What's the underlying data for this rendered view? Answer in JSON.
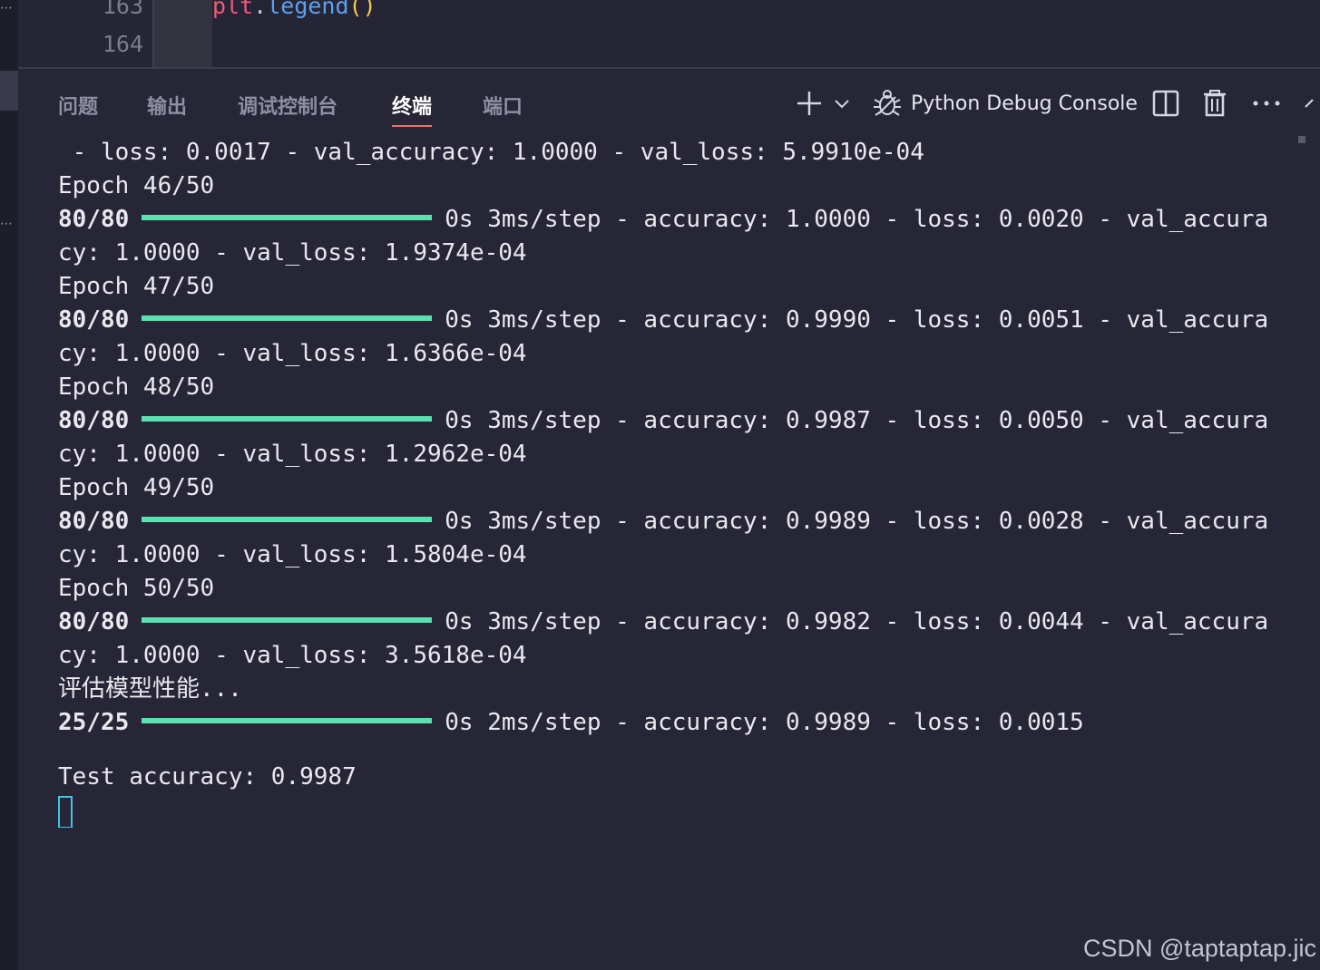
{
  "editor": {
    "line_numbers": [
      "163",
      "164"
    ],
    "code": {
      "var": "plt",
      "dot": ".",
      "fn": "legend",
      "parens": "()"
    }
  },
  "panel": {
    "tabs": [
      {
        "label": "问题"
      },
      {
        "label": "输出"
      },
      {
        "label": "调试控制台"
      },
      {
        "label": "终端",
        "active": true
      },
      {
        "label": "端口"
      }
    ],
    "toolbar": {
      "add_icon": "plus-icon",
      "dropdown_icon": "chevron-down-icon",
      "debug_icon": "bug-icon",
      "console_name": "Python Debug Console",
      "split_icon": "split-icon",
      "trash_icon": "trash-icon",
      "more_icon": "ellipsis-icon",
      "collapse_icon": "chevron-up-icon"
    }
  },
  "terminal": {
    "first_line": " - loss: 0.0017 - val_accuracy: 1.0000 - val_loss: 5.9910e-04",
    "epochs": [
      {
        "header": "Epoch 46/50",
        "steps": "80/80",
        "stats": "0s 3ms/step - accuracy: 1.0000 - loss: 0.0020 - val_accura",
        "wrap": "cy: 1.0000 - val_loss: 1.9374e-04"
      },
      {
        "header": "Epoch 47/50",
        "steps": "80/80",
        "stats": "0s 3ms/step - accuracy: 0.9990 - loss: 0.0051 - val_accura",
        "wrap": "cy: 1.0000 - val_loss: 1.6366e-04"
      },
      {
        "header": "Epoch 48/50",
        "steps": "80/80",
        "stats": "0s 3ms/step - accuracy: 0.9987 - loss: 0.0050 - val_accura",
        "wrap": "cy: 1.0000 - val_loss: 1.2962e-04"
      },
      {
        "header": "Epoch 49/50",
        "steps": "80/80",
        "stats": "0s 3ms/step - accuracy: 0.9989 - loss: 0.0028 - val_accura",
        "wrap": "cy: 1.0000 - val_loss: 1.5804e-04"
      },
      {
        "header": "Epoch 50/50",
        "steps": "80/80",
        "stats": "0s 3ms/step - accuracy: 0.9982 - loss: 0.0044 - val_accura",
        "wrap": "cy: 1.0000 - val_loss: 3.5618e-04"
      }
    ],
    "eval_label": "评估模型性能...",
    "eval_steps": "25/25",
    "eval_stats": "0s 2ms/step - accuracy: 0.9989 - loss: 0.0015",
    "test_accuracy": "Test accuracy: 0.9987",
    "progress_fraction": 1.0,
    "bar_color": "#5de0b0",
    "cursor_color": "#3ec7e6"
  },
  "watermark": "CSDN @taptaptap.jic"
}
